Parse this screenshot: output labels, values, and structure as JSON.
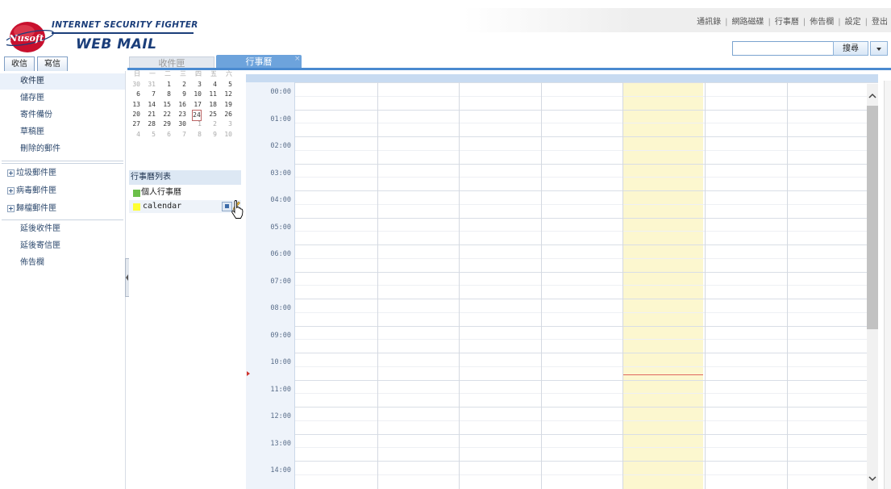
{
  "brand": {
    "line1": "INTERNET SECURITY FIGHTER",
    "line2": "WEB MAIL",
    "logo_text": "Nusoft"
  },
  "top_links": [
    "通訊錄",
    "網路磁碟",
    "行事曆",
    "佈告欄",
    "設定",
    "登出"
  ],
  "search": {
    "value": "",
    "button_label": "搜尋"
  },
  "toolbar": {
    "receive_label": "收信",
    "write_label": "寫信"
  },
  "tabs": [
    {
      "label": "收件匣",
      "active": false
    },
    {
      "label": "行事曆",
      "active": true,
      "close": "×"
    }
  ],
  "sidebar": {
    "folders": [
      "收件匣",
      "儲存匣",
      "寄件備份",
      "草稿匣",
      "刪除的郵件"
    ],
    "expandable": [
      "垃圾郵件匣",
      "病毒郵件匣",
      "歸檔郵件匣"
    ],
    "others": [
      "延後收件匣",
      "延後寄信匣",
      "佈告欄"
    ]
  },
  "mini_calendar": {
    "weekday_headers": [
      "日",
      "一",
      "二",
      "三",
      "四",
      "五",
      "六"
    ],
    "weeks": [
      [
        {
          "d": "30",
          "dim": true
        },
        {
          "d": "31",
          "dim": true
        },
        {
          "d": "1"
        },
        {
          "d": "2"
        },
        {
          "d": "3"
        },
        {
          "d": "4"
        },
        {
          "d": "5"
        }
      ],
      [
        {
          "d": "6"
        },
        {
          "d": "7"
        },
        {
          "d": "8"
        },
        {
          "d": "9"
        },
        {
          "d": "10"
        },
        {
          "d": "11"
        },
        {
          "d": "12"
        }
      ],
      [
        {
          "d": "13"
        },
        {
          "d": "14"
        },
        {
          "d": "15"
        },
        {
          "d": "16"
        },
        {
          "d": "17"
        },
        {
          "d": "18"
        },
        {
          "d": "19"
        }
      ],
      [
        {
          "d": "20"
        },
        {
          "d": "21"
        },
        {
          "d": "22"
        },
        {
          "d": "23"
        },
        {
          "d": "24",
          "today": true
        },
        {
          "d": "25"
        },
        {
          "d": "26"
        }
      ],
      [
        {
          "d": "27"
        },
        {
          "d": "28"
        },
        {
          "d": "29"
        },
        {
          "d": "30"
        },
        {
          "d": "1",
          "dim": true
        },
        {
          "d": "2",
          "dim": true
        },
        {
          "d": "3",
          "dim": true
        }
      ],
      [
        {
          "d": "4",
          "dim": true
        },
        {
          "d": "5",
          "dim": true
        },
        {
          "d": "6",
          "dim": true
        },
        {
          "d": "7",
          "dim": true
        },
        {
          "d": "8",
          "dim": true
        },
        {
          "d": "9",
          "dim": true
        },
        {
          "d": "10",
          "dim": true
        }
      ]
    ]
  },
  "calendar_list": {
    "heading": "行事曆列表",
    "items": [
      {
        "label": "個人行事曆",
        "color": "#6cc04a"
      },
      {
        "label": "calendar",
        "color": "#ffff33"
      }
    ]
  },
  "day_view": {
    "times": [
      "00:00",
      "01:00",
      "02:00",
      "03:00",
      "04:00",
      "05:00",
      "06:00",
      "07:00",
      "08:00",
      "09:00",
      "10:00",
      "11:00",
      "12:00",
      "13:00",
      "14:00"
    ],
    "columns": 7,
    "today_column": 4
  },
  "colors": {
    "accent": "#4a8ad0",
    "tab_active": "#6da3dc",
    "today_bg": "#fcf7cf",
    "now_line": "#e0665e"
  }
}
